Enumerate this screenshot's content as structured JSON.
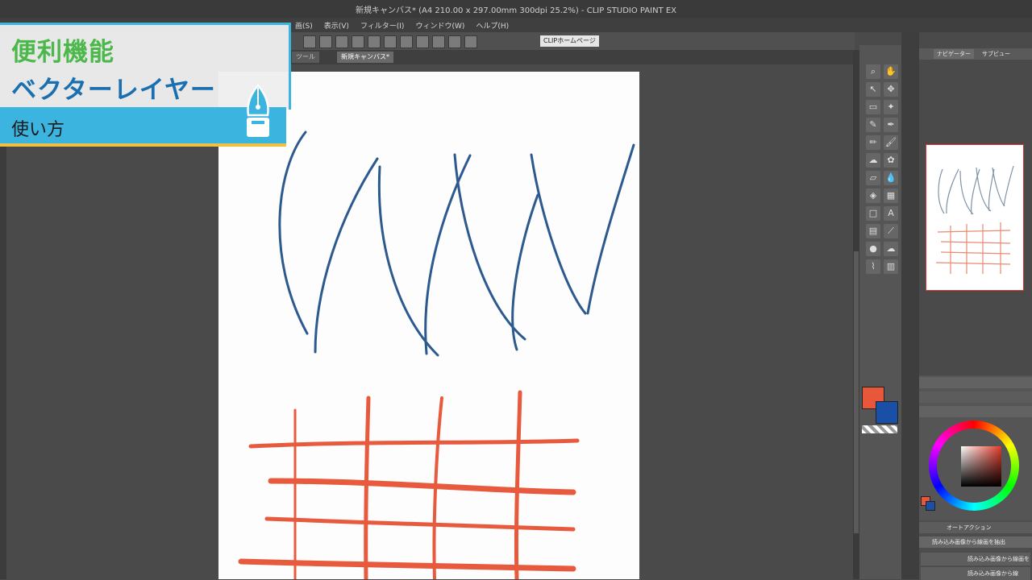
{
  "window": {
    "title": "新規キャンバス* (A4 210.00 x 297.00mm 300dpi 25.2%) - CLIP STUDIO PAINT EX"
  },
  "menu": {
    "items": [
      "画(S)",
      "表示(V)",
      "フィルター(I)",
      "ウィンドウ(W)",
      "ヘルプ(H)"
    ]
  },
  "toolbar": {
    "home_label": "CLIPホームページ"
  },
  "tabs": [
    {
      "label": "ツール"
    },
    {
      "label": "新規キャンバス*"
    }
  ],
  "navigator": {
    "tabs": [
      "ナビゲーター",
      "サブビュー"
    ]
  },
  "layers": {
    "header": "オートアクション",
    "rows": [
      "読み込み画像から線画を抽出",
      "読み込み画像から線"
    ]
  },
  "overlay": {
    "line1": "便利機能",
    "line2": "ベクターレイヤー",
    "line3": "使い方"
  },
  "colors": {
    "main": "#e8573a",
    "sub": "#1a4fa8",
    "accent": "#3cb4e0",
    "stroke_blue": "#2c5a8e",
    "stroke_red": "#e85a3d"
  }
}
